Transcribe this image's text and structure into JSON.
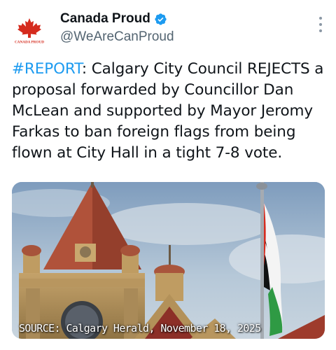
{
  "account": {
    "display_name": "Canada Proud",
    "handle": "@WeAreCanProud",
    "avatar_caption": "CANADA PROUD",
    "verified": true
  },
  "tweet": {
    "hashtag": "#REPORT",
    "text": ": Calgary City Council REJECTS a proposal forwarded by Councillor Dan McLean and supported by Mayor Jeromy Farkas to ban foreign flags from being flown at City Hall in a tight 7-8 vote."
  },
  "media": {
    "caption": "SOURCE: Calgary Herald, November 18, 2025"
  },
  "colors": {
    "link": "#1d9bf0",
    "verified_badge": "#1d9bf0",
    "brand_red": "#d52b1e",
    "muted_text": "#536471"
  },
  "icons": {
    "verified": "verified-badge-icon",
    "more": "more-options-icon",
    "avatar": "maple-leaf-logo"
  }
}
